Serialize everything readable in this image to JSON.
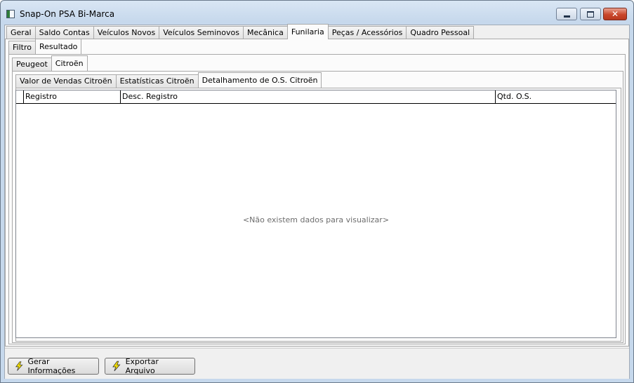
{
  "window": {
    "title": "Snap-On PSA Bi-Marca"
  },
  "main_tabs": [
    {
      "label": "Geral"
    },
    {
      "label": "Saldo Contas"
    },
    {
      "label": "Veículos Novos"
    },
    {
      "label": "Veículos Seminovos"
    },
    {
      "label": "Mecânica"
    },
    {
      "label": "Funilaria"
    },
    {
      "label": "Peças / Acessórios"
    },
    {
      "label": "Quadro Pessoal"
    }
  ],
  "main_active": "Funilaria",
  "sub_tabs": [
    {
      "label": "Filtro"
    },
    {
      "label": "Resultado"
    }
  ],
  "brand_tabs": [
    {
      "label": "Peugeot"
    },
    {
      "label": "Citroën"
    }
  ],
  "report_tabs": [
    {
      "label": "Valor de Vendas Citroën"
    },
    {
      "label": "Estatísticas Citroën"
    },
    {
      "label": "Detalhamento de O.S. Citroën"
    }
  ],
  "grid": {
    "columns": [
      {
        "label": "Registro"
      },
      {
        "label": "Desc. Registro"
      },
      {
        "label": "Qtd. O.S."
      }
    ],
    "empty_message": "<Não existem dados para visualizar>"
  },
  "buttons": {
    "generate": "Gerar Informações",
    "export": "Exportar Arquivo"
  },
  "icons": {
    "bolt": "lightning-bolt-icon",
    "bolt_color": "#f5e000"
  }
}
